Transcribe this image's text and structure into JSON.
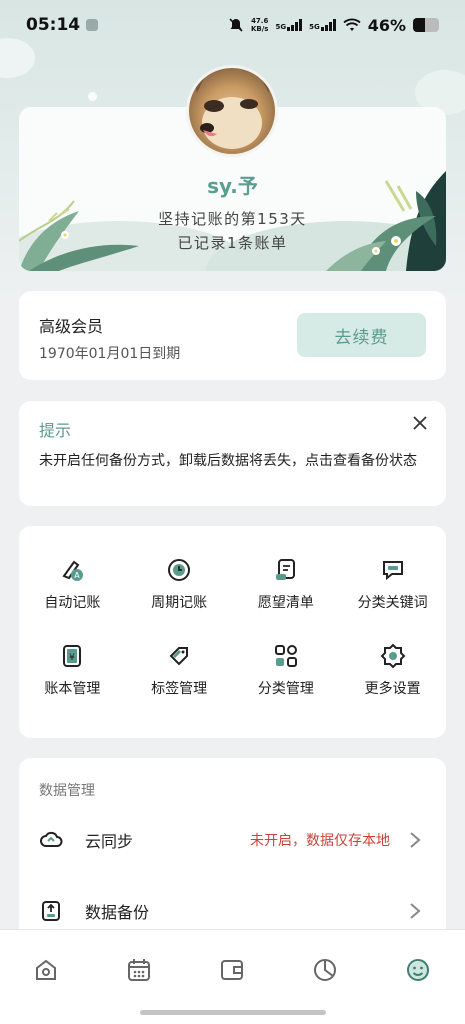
{
  "status_bar": {
    "time": "05:14",
    "net_speed_value": "47.6",
    "net_speed_unit": "KB/s",
    "signal1": "5G",
    "signal2": "5G",
    "battery": "46%",
    "battery_level": 0.46
  },
  "profile": {
    "username": "sy.予",
    "streak": "坚持记账的第153天",
    "records": "已记录1条账单"
  },
  "vip": {
    "title": "高级会员",
    "expiry": "1970年01月01日到期",
    "renew_label": "去续费"
  },
  "tip": {
    "title": "提示",
    "text": "未开启任何备份方式，卸载后数据将丢失，点击查看备份状态"
  },
  "features": [
    {
      "label": "自动记账",
      "icon": "auto-bookkeeping-icon"
    },
    {
      "label": "周期记账",
      "icon": "recurring-icon"
    },
    {
      "label": "愿望清单",
      "icon": "wishlist-icon"
    },
    {
      "label": "分类关键词",
      "icon": "keyword-icon"
    },
    {
      "label": "账本管理",
      "icon": "ledger-icon"
    },
    {
      "label": "标签管理",
      "icon": "tag-icon"
    },
    {
      "label": "分类管理",
      "icon": "category-icon"
    },
    {
      "label": "更多设置",
      "icon": "settings-icon"
    }
  ],
  "data_management": {
    "header": "数据管理",
    "cloud_sync_label": "云同步",
    "cloud_sync_status": "未开启，数据仅存本地",
    "backup_label": "数据备份"
  },
  "tabbar": [
    "home-icon",
    "calendar-icon",
    "wallet-icon",
    "pie-chart-icon",
    "profile-icon"
  ],
  "colors": {
    "accent": "#5b9b8d",
    "warning": "#c9443b",
    "button_bg": "#d6ebe6"
  }
}
